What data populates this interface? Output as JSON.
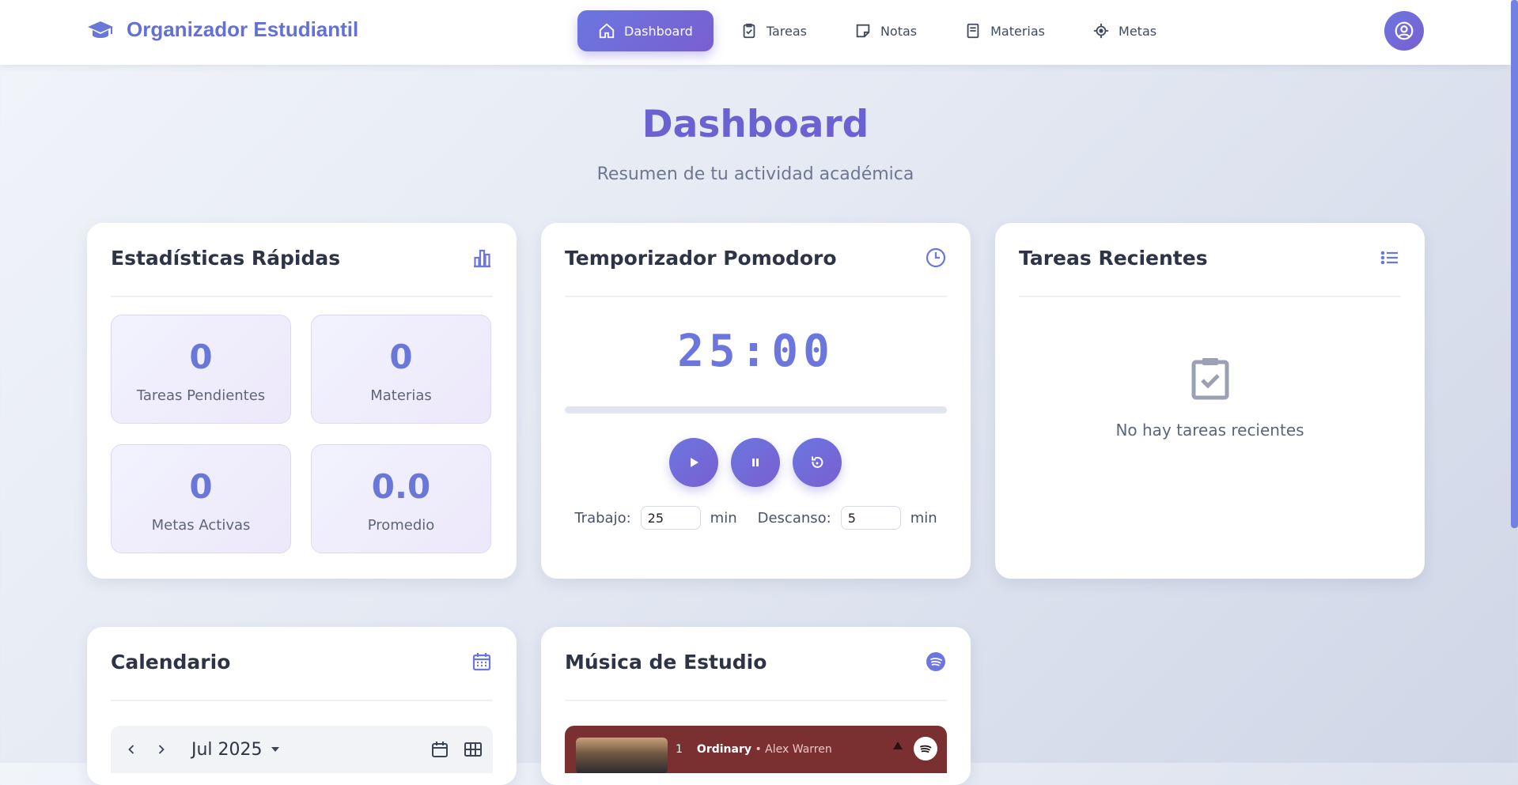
{
  "header": {
    "brand": "Organizador Estudiantil",
    "nav": [
      {
        "label": "Dashboard",
        "icon": "home-icon",
        "active": true
      },
      {
        "label": "Tareas",
        "icon": "task-check-icon",
        "active": false
      },
      {
        "label": "Notas",
        "icon": "note-icon",
        "active": false
      },
      {
        "label": "Materias",
        "icon": "book-icon",
        "active": false
      },
      {
        "label": "Metas",
        "icon": "target-icon",
        "active": false
      }
    ],
    "user_icon": "user-circle-icon"
  },
  "page": {
    "title": "Dashboard",
    "subtitle": "Resumen de tu actividad académica"
  },
  "stats": {
    "title": "Estadísticas Rápidas",
    "icon": "bar-chart-icon",
    "items": [
      {
        "value": "0",
        "label": "Tareas Pendientes"
      },
      {
        "value": "0",
        "label": "Materias"
      },
      {
        "value": "0",
        "label": "Metas Activas"
      },
      {
        "value": "0.0",
        "label": "Promedio"
      }
    ]
  },
  "pomodoro": {
    "title": "Temporizador Pomodoro",
    "icon": "clock-icon",
    "time": "25:00",
    "progress": 0,
    "work_label": "Trabajo:",
    "work_value": "25",
    "break_label": "Descanso:",
    "break_value": "5",
    "unit": "min"
  },
  "recent": {
    "title": "Tareas Recientes",
    "icon": "list-icon",
    "empty_icon": "clipboard-check-icon",
    "empty_text": "No hay tareas recientes"
  },
  "calendar": {
    "title": "Calendario",
    "icon": "calendar-icon",
    "month": "Jul 2025"
  },
  "music": {
    "title": "Música de Estudio",
    "icon": "spotify-icon",
    "track_number": "1",
    "track_name": "Ordinary",
    "track_artist": "Alex Warren"
  },
  "colors": {
    "accent": "#6b76e0",
    "accent_2": "#7a5fd0",
    "title": "#6a62d0"
  }
}
